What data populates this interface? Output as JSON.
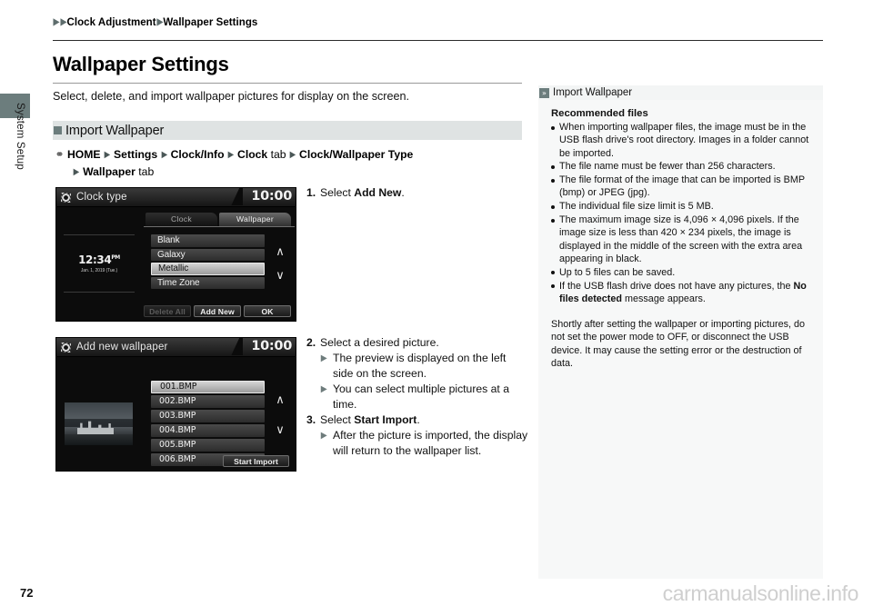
{
  "sidebar": {
    "tab_label": "System Setup"
  },
  "breadcrumb": {
    "item1": "Clock Adjustment",
    "item2": "Wallpaper Settings"
  },
  "header": {
    "title": "Wallpaper Settings",
    "intro": "Select, delete, and import wallpaper pictures for display on the screen."
  },
  "section": {
    "band_label": "Import Wallpaper",
    "nav_home": "HOME",
    "nav_settings": "Settings",
    "nav_clockinfo": "Clock/Info",
    "nav_clock": "Clock",
    "nav_clock_tab": "tab",
    "nav_clock_wallpaper_type": "Clock/Wallpaper Type",
    "nav_wallpaper": "Wallpaper",
    "nav_wallpaper_tab": "tab"
  },
  "device1": {
    "title": "Clock type",
    "clock": "10:00",
    "gear_icon": "gear-icon",
    "tabs": [
      {
        "label": "Clock",
        "active": false
      },
      {
        "label": "Wallpaper",
        "active": true
      }
    ],
    "preview_time": "12:34",
    "preview_time_sup": "PM",
    "preview_date": "Jan. 1, 2019 (Tue.)",
    "list": [
      {
        "label": "Blank",
        "selected": false
      },
      {
        "label": "Galaxy",
        "selected": false
      },
      {
        "label": "Metallic",
        "selected": true
      },
      {
        "label": "Time Zone",
        "selected": false
      }
    ],
    "arrow_up": "∧",
    "arrow_down": "∨",
    "buttons": [
      {
        "label": "Delete All",
        "disabled": true
      },
      {
        "label": "Add New",
        "disabled": false
      },
      {
        "label": "OK",
        "disabled": false
      }
    ]
  },
  "device2": {
    "title": "Add new wallpaper",
    "clock": "10:00",
    "gear_icon": "gear-icon",
    "list": [
      {
        "label": "001.BMP",
        "selected": true
      },
      {
        "label": "002.BMP",
        "selected": false
      },
      {
        "label": "003.BMP",
        "selected": false
      },
      {
        "label": "004.BMP",
        "selected": false
      },
      {
        "label": "005.BMP",
        "selected": false
      },
      {
        "label": "006.BMP",
        "selected": false
      }
    ],
    "arrow_up": "∧",
    "arrow_down": "∨",
    "import_button": "Start Import"
  },
  "steps1": [
    {
      "num": "1.",
      "pre": "Select ",
      "bold": "Add New",
      "post": "."
    }
  ],
  "steps2": [
    {
      "num": "2.",
      "pre": "Select a desired picture.",
      "bold": "",
      "post": "",
      "subs": [
        "The preview is displayed on the left side on the screen.",
        "You can select multiple pictures at a time."
      ]
    },
    {
      "num": "3.",
      "pre": "Select ",
      "bold": "Start Import",
      "post": ".",
      "subs": [
        "After the picture is imported, the display will return to the wallpaper list."
      ]
    }
  ],
  "info": {
    "header_label": "Import Wallpaper",
    "subheading": "Recommended files",
    "bullets": [
      "When importing wallpaper files, the image must be in the USB flash drive's root directory. Images in a folder cannot be imported.",
      "The file name must be fewer than 256 characters.",
      "The file format of the image that can be imported is BMP (bmp) or JPEG (jpg).",
      "The individual file size limit is 5 MB.",
      "The maximum image size is 4,096 × 4,096 pixels. If the image size is less than 420 × 234 pixels, the image is displayed in the middle of the screen with the extra area appearing in black.",
      "Up to 5 files can be saved."
    ],
    "bullet_last_pre": "If the USB flash drive does not have any pictures, the ",
    "bullet_last_bold": "No files detected",
    "bullet_last_post": " message appears.",
    "note": "Shortly after setting the wallpaper or importing pictures, do not set the power mode to OFF, or disconnect the USB device. It may cause the setting error or the destruction of data."
  },
  "footer": {
    "page_number": "72",
    "watermark": "carmanualsonline.info"
  },
  "colors": {
    "accent": "#6c7d7d",
    "band": "#dfe3e3",
    "panel": "#f7f8f8"
  }
}
